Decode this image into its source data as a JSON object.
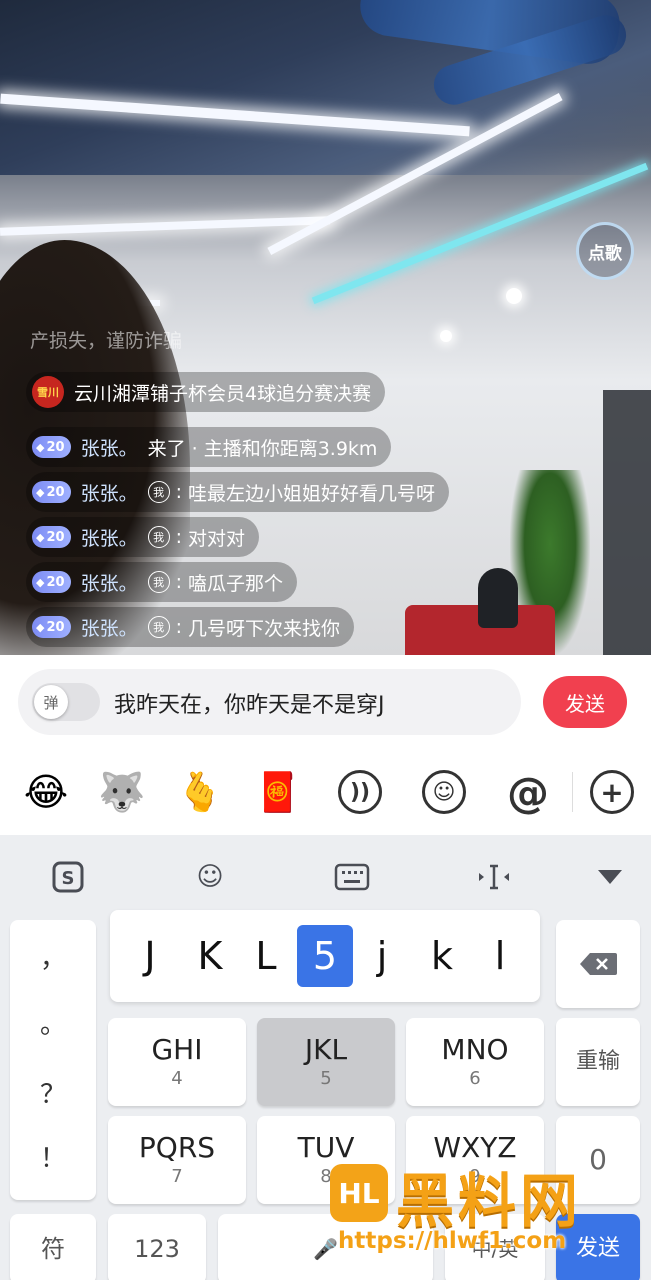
{
  "stream": {
    "song_button": "点歌",
    "faded_message": "产损失，谨防诈骗",
    "system_message": {
      "logo_text": "雪川",
      "text": "云川湘潭铺子杯会员4球追分赛决赛"
    },
    "comments": [
      {
        "level": "20",
        "user": "张张。",
        "me_badge": "",
        "colon": "",
        "text": "来了 · 主播和你距离3.9km"
      },
      {
        "level": "20",
        "user": "张张。",
        "me_badge": "我",
        "colon": ":",
        "text": "哇最左边小姐姐好好看几号呀"
      },
      {
        "level": "20",
        "user": "张张。",
        "me_badge": "我",
        "colon": ":",
        "text": "对对对"
      },
      {
        "level": "20",
        "user": "张张。",
        "me_badge": "我",
        "colon": ":",
        "text": "嗑瓜子那个"
      },
      {
        "level": "20",
        "user": "张张。",
        "me_badge": "我",
        "colon": ":",
        "text": "几号呀下次来找你"
      }
    ]
  },
  "input_bar": {
    "danmu_toggle_label": "弹",
    "input_value": "我昨天在，你昨天是不是穿J",
    "send_label": "发送"
  },
  "emoji_bar": {
    "icons": [
      "laughing-crying-emoji",
      "husky-sticker",
      "heart-hand-sticker",
      "red-envelope-sticker",
      "voice-icon",
      "smiley-icon",
      "at-icon",
      "plus-icon"
    ],
    "at_symbol": "@",
    "plus_symbol": "+"
  },
  "keyboard": {
    "toolbar": [
      "sogou-logo-icon",
      "emoji-icon",
      "keyboard-icon",
      "cursor-icon",
      "collapse-icon"
    ],
    "candidates": [
      "J",
      "K",
      "L",
      "5",
      "j",
      "k",
      "l"
    ],
    "selected_candidate_index": 3,
    "punctuation": [
      "，",
      "。",
      "？",
      "！"
    ],
    "keys": {
      "ghi": {
        "main": "GHI",
        "sub": "4"
      },
      "jkl": {
        "main": "JKL",
        "sub": "5"
      },
      "mno": {
        "main": "MNO",
        "sub": "6"
      },
      "pqrs": {
        "main": "PQRS",
        "sub": "7"
      },
      "tuv": {
        "main": "TUV",
        "sub": "8"
      },
      "wxyz": {
        "main": "WXYZ",
        "sub": "9"
      },
      "delete": "⌫",
      "reenter": "重输",
      "zero": "0",
      "symbols": "符",
      "numbers": "123",
      "space": "🎤",
      "lang": "中/英",
      "send": "发送"
    }
  },
  "watermark": {
    "logo_text": "HL",
    "title": "黑料网",
    "url": "https://hlwf1.com"
  }
}
